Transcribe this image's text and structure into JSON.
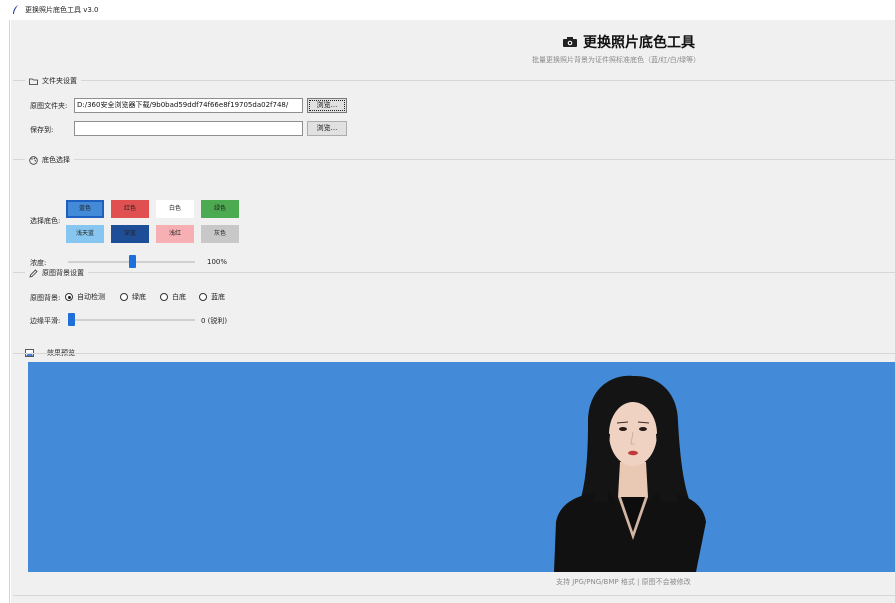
{
  "window": {
    "title": "更换照片底色工具 v3.0"
  },
  "header": {
    "title": "更换照片底色工具",
    "subtitle": "批量更换照片背景为证件照标准底色（蓝/红/白/绿等）"
  },
  "folder_section": {
    "title": "文件夹设置",
    "source_label": "原图文件夹:",
    "source_value": "D:/360安全浏览器下载/9b0bad59ddf74f66e8f19705da02f748/",
    "save_label": "保存到:",
    "save_value": "",
    "browse_label": "浏览..."
  },
  "color_section": {
    "title": "底色选择",
    "choose_label": "选择底色:",
    "swatches": [
      {
        "label": "蓝色",
        "color": "#438bd8",
        "selected": true
      },
      {
        "label": "红色",
        "color": "#e05050",
        "selected": false
      },
      {
        "label": "白色",
        "color": "#ffffff",
        "selected": false
      },
      {
        "label": "绿色",
        "color": "#4caa50",
        "selected": false
      },
      {
        "label": "浅天蓝",
        "color": "#86c6f0",
        "selected": false
      },
      {
        "label": "深蓝",
        "color": "#1f4e99",
        "selected": false
      },
      {
        "label": "浅红",
        "color": "#f6b0b4",
        "selected": false
      },
      {
        "label": "灰色",
        "color": "#c8c8c8",
        "selected": false
      }
    ],
    "intensity_label": "浓度:",
    "intensity_value": "100%",
    "intensity_level": 1.0
  },
  "bg_section": {
    "title": "原图背景设置",
    "bg_label": "原图背景:",
    "options": [
      "自动检测",
      "绿底",
      "白底",
      "蓝底"
    ],
    "selected_option": 0,
    "smooth_label": "边缘平滑:",
    "smooth_value": "0 (锐利)",
    "smooth_level": 0
  },
  "preview_section": {
    "title": "效果预览",
    "background_color": "#438bd8",
    "caption": "支持 JPG/PNG/BMP 格式 | 原图不会被修改"
  }
}
